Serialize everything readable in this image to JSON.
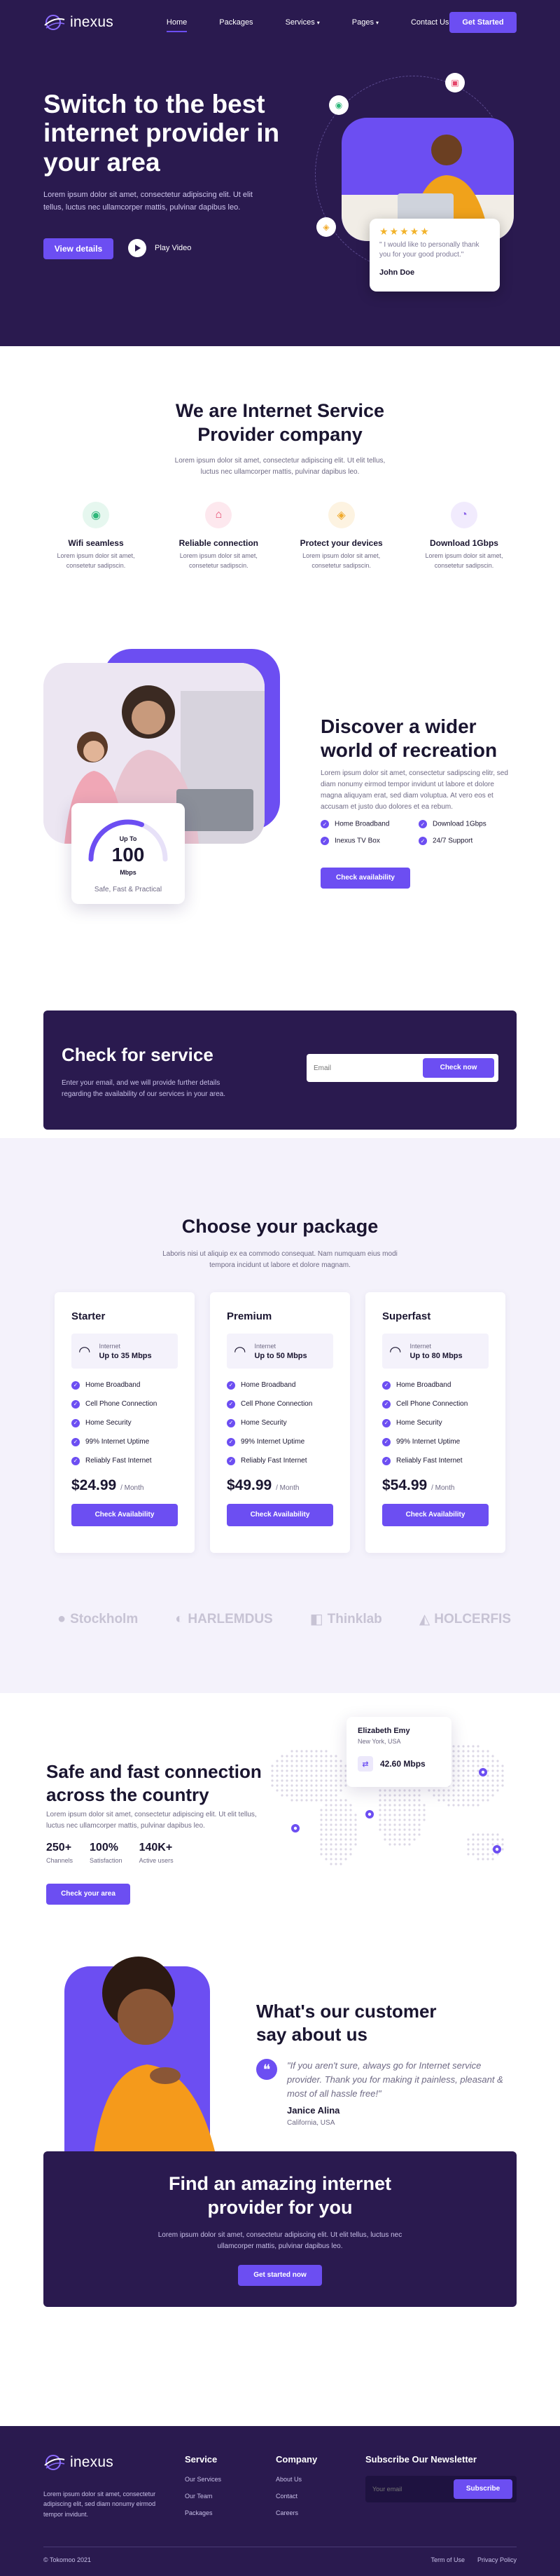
{
  "colors": {
    "primary": "#6c4ef2",
    "dark": "#2a1a4f",
    "light_bg": "#f4f2fb",
    "star": "#f2b32b"
  },
  "nav": {
    "logo": "inexus",
    "links": [
      {
        "label": "Home"
      },
      {
        "label": "Packages"
      },
      {
        "label": "Services"
      },
      {
        "label": "Pages"
      },
      {
        "label": "Contact Us"
      }
    ],
    "cta": "Get Started"
  },
  "hero": {
    "title": "Switch to the best internet provider in your area",
    "desc": "Lorem ipsum dolor sit amet, consectetur adipiscing elit. Ut elit tellus, luctus nec ullamcorper mattis, pulvinar dapibus leo.",
    "cta": "View details",
    "play": "Play Video",
    "review": {
      "stars": "★★★★★",
      "quote": "\" I would like to personally thank you for your good product.\"",
      "name": "John Doe"
    }
  },
  "about": {
    "title": "We are Internet Service Provider company",
    "desc": "Lorem ipsum dolor sit amet, consectetur adipiscing elit. Ut elit tellus, luctus nec ullamcorper mattis, pulvinar dapibus leo.",
    "features": [
      {
        "title": "Wifi seamless",
        "desc": "Lorem ipsum dolor sit amet, consetetur sadipscin.",
        "icon": "wifi-icon",
        "color": "#2fb77a",
        "bg": "#e6f7ef"
      },
      {
        "title": "Reliable connection",
        "desc": "Lorem ipsum dolor sit amet, consetetur sadipscin.",
        "icon": "home-icon",
        "color": "#e5466b",
        "bg": "#fde8ee"
      },
      {
        "title": "Protect your devices",
        "desc": "Lorem ipsum dolor sit amet, consetetur sadipscin.",
        "icon": "shield-icon",
        "color": "#f0a92a",
        "bg": "#fdf3e1"
      },
      {
        "title": "Download 1Gbps",
        "desc": "Lorem ipsum dolor sit amet, consetetur sadipscin.",
        "icon": "gauge-icon",
        "color": "#8a62e8",
        "bg": "#f1ebfd"
      }
    ]
  },
  "discover": {
    "gauge": {
      "up": "Up To",
      "value": "100",
      "unit": "Mbps",
      "caption": "Safe, Fast & Practical",
      "fill": 0.62
    },
    "title": "Discover a wider world of recreation",
    "desc": "Lorem ipsum dolor sit amet, consectetur sadipscing elitr, sed diam nonumy eirmod tempor invidunt ut labore et dolore magna aliquyam erat, sed diam voluptua. At vero eos et accusam et justo duo dolores et ea rebum.",
    "list": [
      "Home Broadband",
      "Download 1Gbps",
      "Inexus TV Box",
      "24/7 Support"
    ],
    "cta": "Check availability"
  },
  "check": {
    "title": "Check for service",
    "desc": "Enter your email, and we will provide further details regarding the availability of our services in your area.",
    "placeholder": "Email",
    "cta": "Check now"
  },
  "packages": {
    "title": "Choose your package",
    "desc": "Laboris nisi ut aliquip ex ea commodo consequat. Nam numquam eius modi tempora incidunt ut labore et dolore magnam.",
    "plans": [
      {
        "name": "Starter",
        "net_label": "Internet",
        "speed": "Up to 35 Mbps",
        "features": [
          "Home Broadband",
          "Cell Phone Connection",
          "Home Security",
          "99% Internet Uptime",
          "Reliably Fast Internet"
        ],
        "price": "$24.99",
        "period": "/ Month",
        "cta": "Check Availability"
      },
      {
        "name": "Premium",
        "net_label": "Internet",
        "speed": "Up to 50 Mbps",
        "features": [
          "Home Broadband",
          "Cell Phone Connection",
          "Home Security",
          "99% Internet Uptime",
          "Reliably Fast Internet"
        ],
        "price": "$49.99",
        "period": "/ Month",
        "cta": "Check Availability"
      },
      {
        "name": "Superfast",
        "net_label": "Internet",
        "speed": "Up to 80 Mbps",
        "features": [
          "Home Broadband",
          "Cell Phone Connection",
          "Home Security",
          "99% Internet Uptime",
          "Reliably Fast Internet"
        ],
        "price": "$54.99",
        "period": "/ Month",
        "cta": "Check Availability"
      }
    ]
  },
  "brands": [
    "Stockholm",
    "HARLEMDUS",
    "Thinklab",
    "HOLCERFIS"
  ],
  "coverage": {
    "title": "Safe and fast connection across the country",
    "desc": "Lorem ipsum dolor sit amet, consectetur adipiscing elit. Ut elit tellus, luctus nec ullamcorper mattis, pulvinar dapibus leo.",
    "stats": [
      {
        "value": "250+",
        "label": "Channels"
      },
      {
        "value": "100%",
        "label": "Satisfaction"
      },
      {
        "value": "140K+",
        "label": "Active users"
      }
    ],
    "cta": "Check your area",
    "location": {
      "name": "Elizabeth Emy",
      "place": "New York, USA",
      "speed": "42.60 Mbps"
    }
  },
  "testimonial": {
    "title": "What's our customer say about us",
    "quote": "\"If you aren't sure, always go for Internet service provider. Thank you for making it painless, pleasant & most of all hassle free!\"",
    "name": "Janice Alina",
    "location": "California, USA"
  },
  "cta": {
    "title": "Find an amazing internet provider for you",
    "desc": "Lorem ipsum dolor sit amet, consectetur adipiscing elit. Ut elit tellus, luctus nec ullamcorper mattis, pulvinar dapibus leo.",
    "button": "Get started now"
  },
  "footer": {
    "logo": "inexus",
    "desc": "Lorem ipsum dolor sit amet, consectetur adipiscing elit, sed diam nonumy eirmod tempor invidunt.",
    "service": {
      "title": "Service",
      "links": [
        "Our Services",
        "Our Team",
        "Packages"
      ]
    },
    "company": {
      "title": "Company",
      "links": [
        "About Us",
        "Contact",
        "Careers"
      ]
    },
    "newsletter": {
      "title": "Subscribe Our Newsletter",
      "placeholder": "Your email",
      "button": "Subscribe"
    },
    "copyright": "© Tokomoo 2021",
    "legal": [
      "Term of Use",
      "Privacy Policy"
    ]
  }
}
